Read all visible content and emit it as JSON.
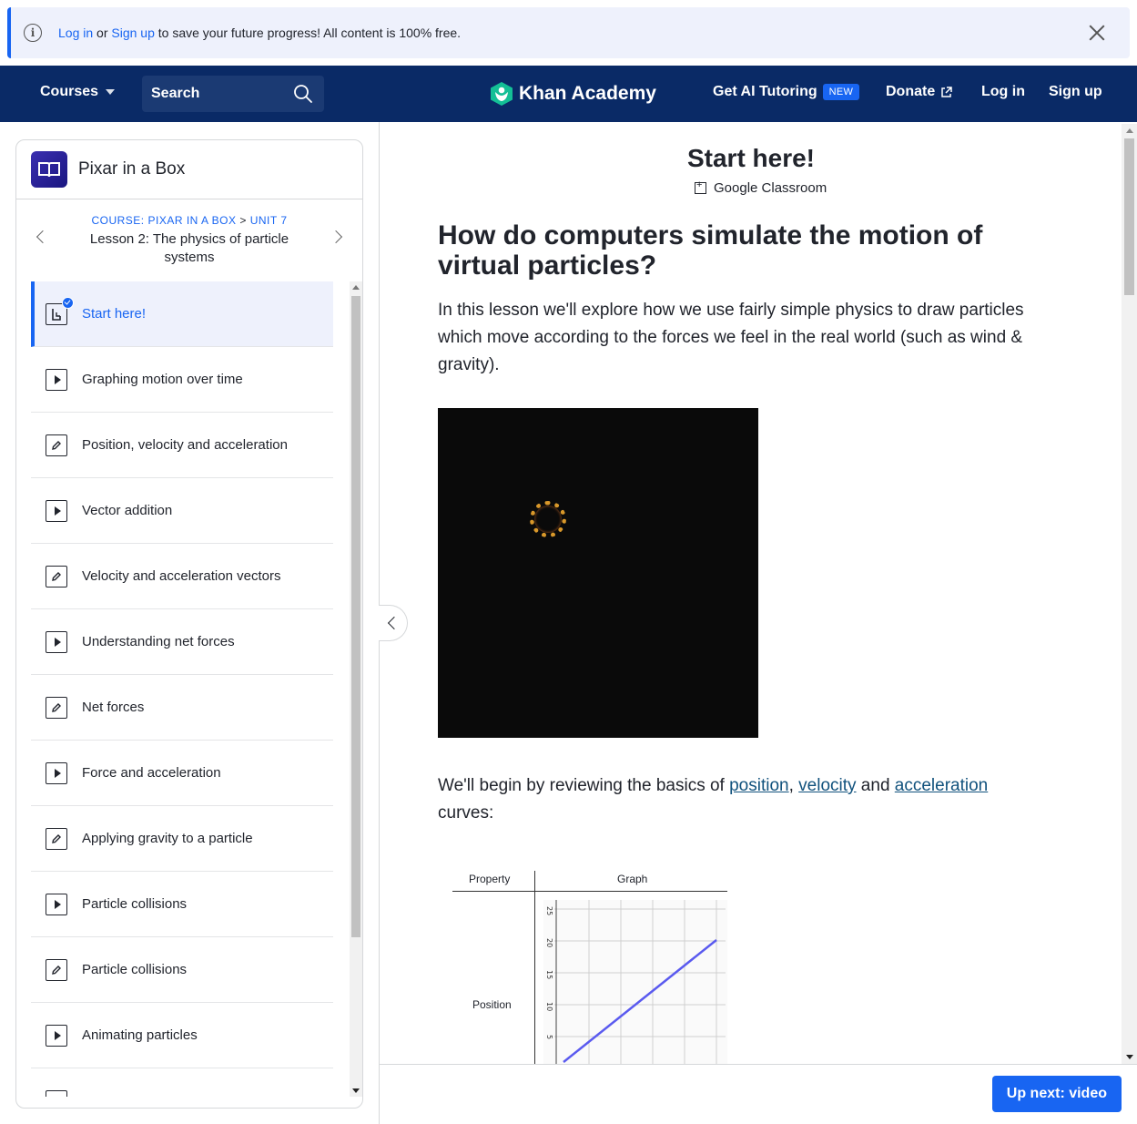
{
  "banner": {
    "login": "Log in",
    "or": "or",
    "signup": "Sign up",
    "message": "to save your future progress! All content is 100% free."
  },
  "header": {
    "courses": "Courses",
    "search": "Search",
    "logo": "Khan Academy",
    "ai_tutoring": "Get AI Tutoring",
    "new_badge": "NEW",
    "donate": "Donate",
    "login": "Log in",
    "signup": "Sign up"
  },
  "sidebar": {
    "course_title": "Pixar in a Box",
    "crumb_course": "COURSE: PIXAR IN A BOX",
    "crumb_sep": ">",
    "crumb_unit": "UNIT 7",
    "lesson_title": "Lesson 2: The physics of particle systems",
    "items": [
      {
        "label": "Start here!",
        "type": "article"
      },
      {
        "label": "Graphing motion over time",
        "type": "video"
      },
      {
        "label": "Position, velocity and acceleration",
        "type": "exercise"
      },
      {
        "label": "Vector addition",
        "type": "video"
      },
      {
        "label": "Velocity and acceleration vectors",
        "type": "exercise"
      },
      {
        "label": "Understanding net forces",
        "type": "video"
      },
      {
        "label": "Net forces",
        "type": "exercise"
      },
      {
        "label": "Force and acceleration",
        "type": "video"
      },
      {
        "label": "Applying gravity to a particle",
        "type": "exercise"
      },
      {
        "label": "Particle collisions",
        "type": "video"
      },
      {
        "label": "Particle collisions",
        "type": "exercise"
      },
      {
        "label": "Animating particles",
        "type": "video"
      }
    ]
  },
  "main": {
    "title": "Start here!",
    "google_classroom": "Google Classroom",
    "heading": "How do computers simulate the motion of virtual particles?",
    "intro": "In this lesson we'll explore how we use fairly simple physics to draw particles which move according to the forces we feel in the real world (such as wind & gravity).",
    "review_pre": "We'll begin by reviewing the basics of ",
    "link_position": "position",
    "comma": ",",
    "link_velocity": "velocity",
    "and": " and ",
    "link_acceleration": "acceleration",
    "review_post": "curves:",
    "table": {
      "col_property": "Property",
      "col_graph": "Graph",
      "row_position": "Position",
      "y_ticks": [
        "25",
        "20",
        "15",
        "10",
        "5"
      ]
    }
  },
  "footer": {
    "up_next": "Up next: video"
  },
  "colors": {
    "brand_blue": "#1865f2",
    "header_navy": "#0a2a66"
  }
}
